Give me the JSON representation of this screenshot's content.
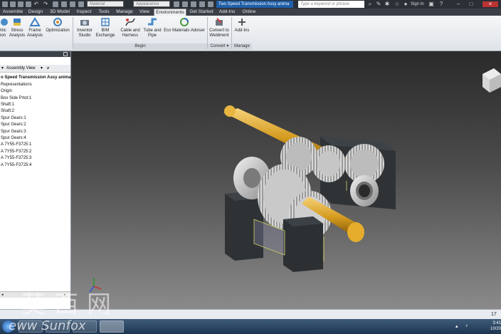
{
  "titlebar": {
    "material_placeholder": "Material",
    "appearance_placeholder": "Appearance",
    "document_title": "Two Speed Transmission Assy anima",
    "search_placeholder": "Type a keyword or phrase",
    "signin_label": "Sign In"
  },
  "tabs": [
    {
      "label": "Assemble",
      "active": false
    },
    {
      "label": "Design",
      "active": false
    },
    {
      "label": "3D Model",
      "active": false
    },
    {
      "label": "Inspect",
      "active": false
    },
    {
      "label": "Tools",
      "active": false
    },
    {
      "label": "Manage",
      "active": false
    },
    {
      "label": "View",
      "active": false
    },
    {
      "label": "Environments",
      "active": true
    },
    {
      "label": "Get Started",
      "active": false
    },
    {
      "label": "Add-Ins",
      "active": false
    },
    {
      "label": "Online",
      "active": false
    }
  ],
  "ribbon": {
    "buttons": [
      {
        "line1": "mic",
        "line2": "ion"
      },
      {
        "line1": "Stress",
        "line2": "Analysis"
      },
      {
        "line1": "Frame",
        "line2": "Analysis"
      },
      {
        "line1": "Optimization",
        "line2": ""
      },
      {
        "line1": "Inventor",
        "line2": "Studio"
      },
      {
        "line1": "BIM",
        "line2": "Exchange"
      },
      {
        "line1": "Cable and",
        "line2": "Harness"
      },
      {
        "line1": "Tube and",
        "line2": "Pipe"
      },
      {
        "line1": "Eco Materials Adviser",
        "line2": ""
      },
      {
        "line1": "Convert to",
        "line2": "Weldment"
      },
      {
        "line1": "Add-Ins",
        "line2": ""
      }
    ],
    "panels": {
      "begin": "Begin",
      "convert": "Convert ▾",
      "manage": "Manage"
    }
  },
  "browser": {
    "view_label": "Assembly View",
    "root": "o Speed Transmission Assy anima",
    "items": [
      "Representations",
      "Origin",
      "Box Side Prtot:1",
      "Shaft:1",
      "Shaft:2",
      "Spur Gears:1",
      "Spur Gears:2",
      "Spur Gears:3",
      "Spur Gears:4",
      "A 7Y55-F3725:1",
      "A 7Y55-F3725:2",
      "A 7Y55-F3725:3",
      "A 7Y55-F3725:4"
    ]
  },
  "statusbar": {
    "count": "17"
  },
  "clock": {
    "time": "3:41",
    "date": "10/20"
  },
  "watermark": {
    "cn": "莫西网",
    "latin": "eww    Sunfox"
  }
}
